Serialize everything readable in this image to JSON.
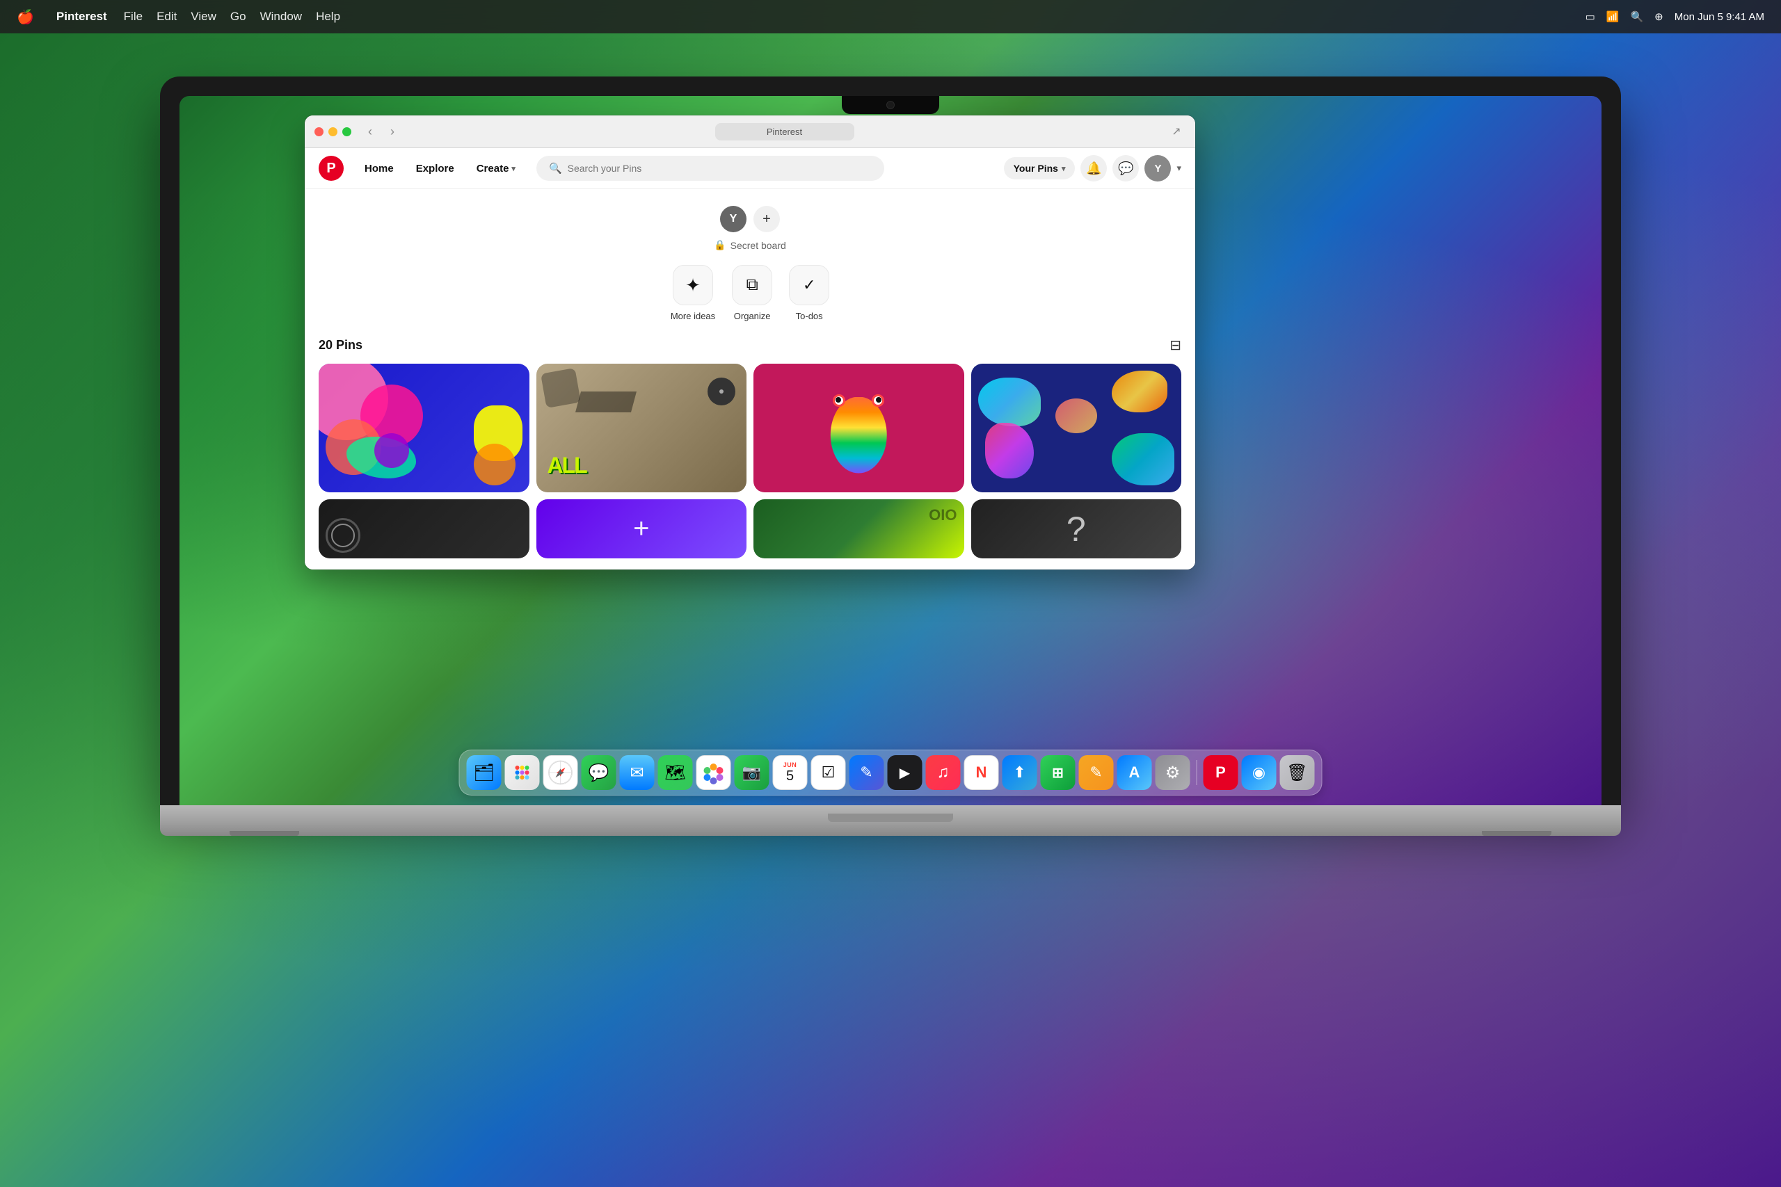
{
  "desktop": {
    "time": "Mon Jun 5  9:41 AM"
  },
  "menubar": {
    "apple": "🍎",
    "app_name": "Pinterest",
    "items": [
      "File",
      "Edit",
      "View",
      "Go",
      "Window",
      "Help"
    ],
    "right_icons": [
      "battery",
      "wifi",
      "search",
      "control"
    ]
  },
  "browser": {
    "title": "Pinterest",
    "url": "Pinterest",
    "nav": {
      "back": "‹",
      "forward": "›"
    }
  },
  "pinterest": {
    "nav": {
      "home": "Home",
      "explore": "Explore",
      "create": "Create",
      "create_chevron": "▾",
      "search_placeholder": "Search your Pins",
      "your_pins": "Your Pins",
      "your_pins_chevron": "▾"
    },
    "board": {
      "avatar_letter": "Y",
      "add_label": "+",
      "secret_label": "Secret board",
      "lock_icon": "🔒"
    },
    "actions": [
      {
        "icon": "✦",
        "label": "More ideas"
      },
      {
        "icon": "⧉",
        "label": "Organize"
      },
      {
        "icon": "✓",
        "label": "To-dos"
      }
    ],
    "pins": {
      "count": "20 Pins",
      "filter_icon": "⊟"
    }
  },
  "dock": {
    "items": [
      {
        "name": "Finder",
        "class": "dock-finder",
        "icon": "🗂"
      },
      {
        "name": "Launchpad",
        "class": "dock-launchpad",
        "icon": "⊞"
      },
      {
        "name": "Safari",
        "class": "dock-safari",
        "icon": "🧭"
      },
      {
        "name": "Messages",
        "class": "dock-messages",
        "icon": "💬"
      },
      {
        "name": "Mail",
        "class": "dock-mail",
        "icon": "✉"
      },
      {
        "name": "Maps",
        "class": "dock-maps",
        "icon": "🗺"
      },
      {
        "name": "Photos",
        "class": "dock-photos",
        "icon": "⬡"
      },
      {
        "name": "FaceTime",
        "class": "dock-facetime",
        "icon": "📷"
      },
      {
        "name": "Calendar",
        "class": "dock-calendar",
        "icon": "",
        "num": "5",
        "day": "Jun"
      },
      {
        "name": "Reminders",
        "class": "dock-reminders",
        "icon": "☑"
      },
      {
        "name": "Freeform",
        "class": "dock-freeform",
        "icon": "✎"
      },
      {
        "name": "AppleTV",
        "class": "dock-appletv",
        "icon": "▶"
      },
      {
        "name": "Music",
        "class": "dock-music",
        "icon": "♫"
      },
      {
        "name": "News",
        "class": "dock-news",
        "icon": "N"
      },
      {
        "name": "Transloader",
        "class": "dock-transloader",
        "icon": "⬆"
      },
      {
        "name": "Numbers",
        "class": "dock-numbers",
        "icon": "⊞"
      },
      {
        "name": "Pages",
        "class": "dock-pages",
        "icon": "✎"
      },
      {
        "name": "AppStore",
        "class": "dock-appstore",
        "icon": "A"
      },
      {
        "name": "SystemPreferences",
        "class": "dock-syspreferences",
        "icon": "⚙"
      },
      {
        "name": "Pinterest",
        "class": "dock-pinterest",
        "icon": "P"
      },
      {
        "name": "Unknown",
        "class": "dock-unknown",
        "icon": "◉"
      },
      {
        "name": "Trash",
        "class": "dock-trash",
        "icon": "🗑"
      }
    ]
  }
}
